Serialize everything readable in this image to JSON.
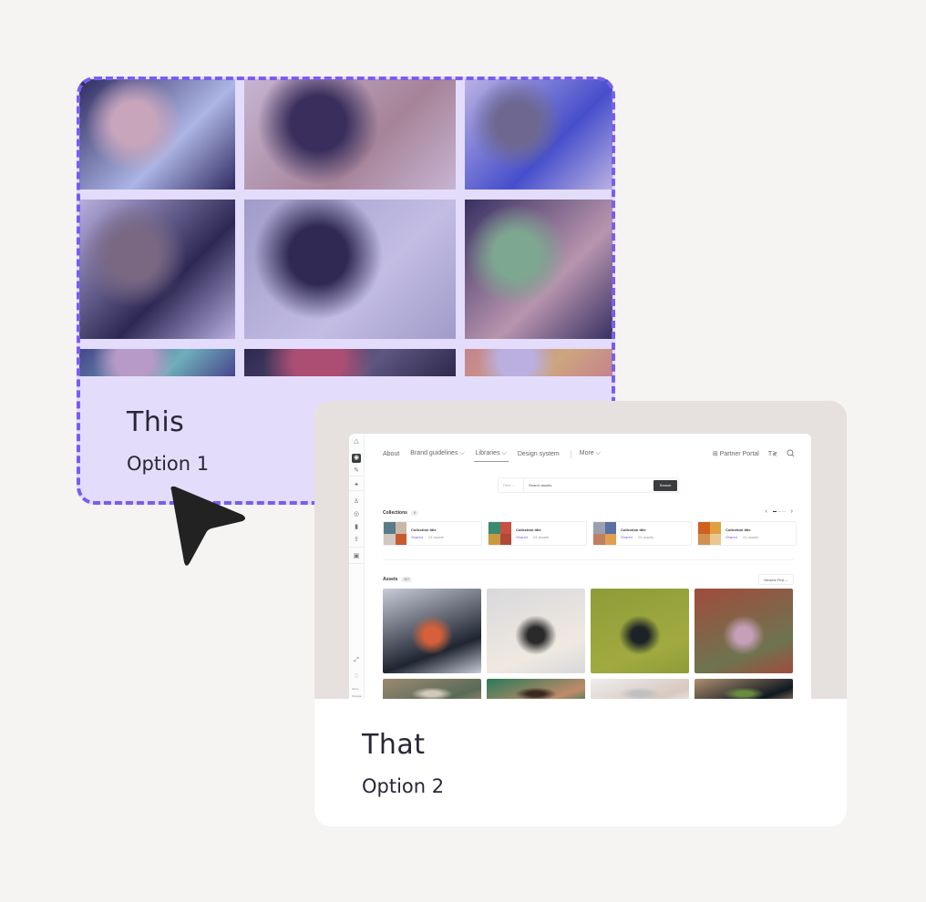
{
  "option1": {
    "title": "This",
    "subtitle": "Option 1",
    "border_color": "#7a5cf0",
    "background": "#e4dcfb",
    "photos": [
      {
        "name": "woman-with-eye-patch",
        "colors": [
          "#1f1f46",
          "#b8c8e6",
          "#d9b4b4"
        ]
      },
      {
        "name": "woman-closeup-portrait",
        "colors": [
          "#d8c6cf",
          "#b08a8a",
          "#2b2340"
        ]
      },
      {
        "name": "group-photoshoot",
        "colors": [
          "#c9c3e4",
          "#3b4ac8",
          "#6c6a80"
        ]
      },
      {
        "name": "photographer-with-camera",
        "colors": [
          "#c6c0e0",
          "#1d1b36",
          "#7a6a70"
        ]
      },
      {
        "name": "reflector-setup",
        "colors": [
          "#a9a8c4",
          "#d3d1e6",
          "#1f1d36"
        ]
      },
      {
        "name": "friends-hugging",
        "colors": [
          "#2a2548",
          "#c6a0a4",
          "#7fb680"
        ]
      },
      {
        "name": "clothing-rack",
        "colors": [
          "#3d3f7a",
          "#6cc0b2",
          "#c5a7c3"
        ]
      },
      {
        "name": "camera-equipment",
        "colors": [
          "#1e1c2e",
          "#58546c",
          "#b84a5c"
        ]
      },
      {
        "name": "colorful-sweater",
        "colors": [
          "#d48a7c",
          "#e0b46a",
          "#c9c0e0"
        ]
      }
    ]
  },
  "option2": {
    "title": "That",
    "subtitle": "Option 2",
    "app": {
      "nav": {
        "items": [
          {
            "label": "About",
            "dropdown": false
          },
          {
            "label": "Brand guidelines",
            "dropdown": true
          },
          {
            "label": "Libraries",
            "dropdown": true,
            "active": true
          },
          {
            "label": "Design system",
            "dropdown": false
          },
          {
            "label": "More",
            "dropdown": true
          }
        ],
        "partner_portal": "Partner Portal",
        "chevron": "⌵"
      },
      "sidebar": {
        "icons": [
          "logo-icon",
          "home-icon",
          "brush-icon",
          "rocket-icon",
          "users-icon",
          "settings-icon",
          "chart-icon",
          "upload-icon",
          "briefcase-icon",
          "expand-icon",
          "bell-icon"
        ],
        "storage_label": "Storage",
        "items_label": "Items"
      },
      "search": {
        "filter_label": "Filter",
        "placeholder": "Search assets",
        "button_label": "Search"
      },
      "collections": {
        "label": "Collections",
        "count": "8",
        "items": [
          {
            "title": "Collection title",
            "shared": "Shared",
            "assets": "24 assets",
            "thumbs": [
              "#5a7a8a",
              "#c9b8a8",
              "#d0c8c0",
              "#c85a30"
            ]
          },
          {
            "title": "Collection title",
            "shared": "Shared",
            "assets": "24 assets",
            "thumbs": [
              "#3a8a70",
              "#c85040",
              "#c89a40",
              "#b04838"
            ]
          },
          {
            "title": "Collection title",
            "shared": "Shared",
            "assets": "24 assets",
            "thumbs": [
              "#9aa0b0",
              "#5a70a0",
              "#c08060",
              "#e0a050"
            ]
          },
          {
            "title": "Collection title",
            "shared": "Shared",
            "assets": "24 assets",
            "thumbs": [
              "#d06020",
              "#e0a040",
              "#d09050",
              "#e8c890"
            ]
          }
        ]
      },
      "assets": {
        "label": "Assets",
        "count": "567",
        "sort_label": "Newest First",
        "items": [
          {
            "name": "two-friends-sitting",
            "colors": [
              "#c9cbd8",
              "#1e2530",
              "#d5603a"
            ]
          },
          {
            "name": "person-on-rug",
            "colors": [
              "#d8d8dc",
              "#efe9e0",
              "#2a2a2a"
            ]
          },
          {
            "name": "jump-rope-on-field",
            "colors": [
              "#8e9c38",
              "#a0aa40",
              "#1d2226"
            ]
          },
          {
            "name": "stretching-on-track",
            "colors": [
              "#a04c3c",
              "#6e7450",
              "#c5a0b8"
            ]
          },
          {
            "name": "workout-row2-1",
            "colors": [
              "#9c8a70",
              "#5a6a58",
              "#d0c8b8"
            ]
          },
          {
            "name": "workout-row2-2",
            "colors": [
              "#2a7a58",
              "#c08a6a",
              "#3a2a20"
            ]
          },
          {
            "name": "skincare-row2-3",
            "colors": [
              "#eeeeee",
              "#d8c8c0",
              "#c0c0c0"
            ]
          },
          {
            "name": "workout-row2-4",
            "colors": [
              "#b09070",
              "#101820",
              "#6a8a40"
            ]
          }
        ]
      }
    }
  }
}
